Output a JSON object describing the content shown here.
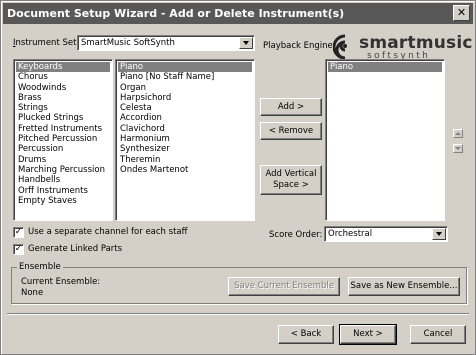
{
  "title": "Document Setup Wizard - Add or Delete Instrument(s)",
  "close_glyph": "✕",
  "instrument_set": {
    "label_prefix": "I",
    "label_rest": "nstrument Set:",
    "value": "SmartMusic SoftSynth"
  },
  "playback_engine": {
    "label": "Playback Engine:",
    "logo_main": "smartmusic",
    "logo_sub": "softsynth"
  },
  "categories": [
    "Keyboards",
    "Chorus",
    "Woodwinds",
    "Brass",
    "Strings",
    "Plucked Strings",
    "Fretted Instruments",
    "Pitched Percussion",
    "Percussion",
    "Drums",
    "Marching Percussion",
    "Handbells",
    "Orff Instruments",
    "Empty Staves"
  ],
  "instruments": [
    "Piano",
    "Piano [No Staff Name]",
    "Organ",
    "Harpsichord",
    "Celesta",
    "Accordion",
    "Clavichord",
    "Harmonium",
    "Synthesizer",
    "Theremin",
    "Ondes Martenot"
  ],
  "score": [
    "Piano"
  ],
  "buttons": {
    "add": "Add >",
    "remove": "< Remove",
    "add_vertical_space_1": "Add Vertical",
    "add_vertical_space_2": "Space >",
    "save_current_ensemble": "Save Current Ensemble",
    "save_as_new_ensemble": "Save as New Ensemble...",
    "back": "< Back",
    "next": "Next >",
    "cancel": "Cancel"
  },
  "options": {
    "separate_channel": "Use a separate channel for each staff",
    "generate_linked_parts": "Generate Linked Parts"
  },
  "score_order": {
    "label": "Score Order:",
    "value": "Orchestral"
  },
  "ensemble": {
    "group_label": "Ensemble",
    "current_label": "Current Ensemble:",
    "current_value": "None"
  },
  "check_glyph": "✓"
}
